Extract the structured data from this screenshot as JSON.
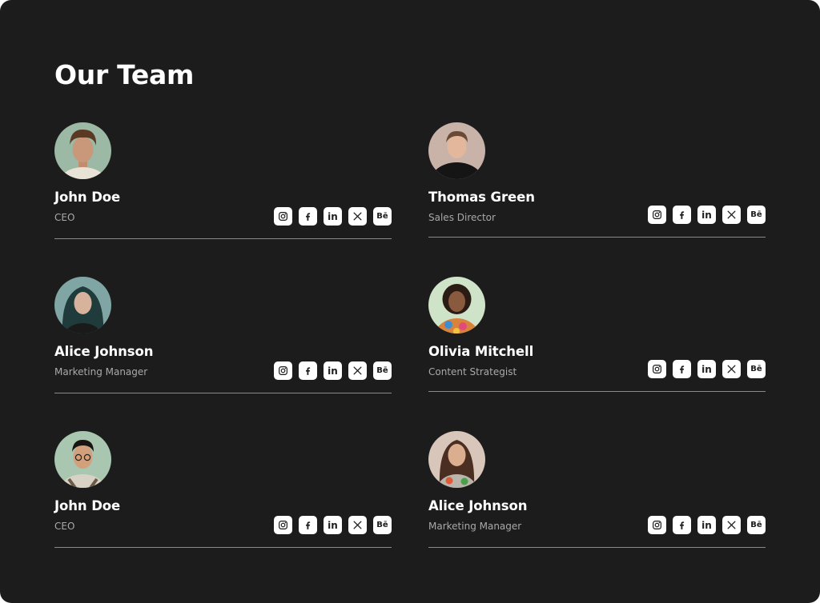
{
  "page": {
    "title": "Our Team"
  },
  "members": [
    {
      "name": "John Doe",
      "role": "CEO"
    },
    {
      "name": "Thomas Green",
      "role": "Sales Director"
    },
    {
      "name": "Alice Johnson",
      "role": "Marketing Manager"
    },
    {
      "name": "Olivia Mitchell",
      "role": "Content Strategist"
    },
    {
      "name": "John Doe",
      "role": "CEO"
    },
    {
      "name": "Alice Johnson",
      "role": "Marketing Manager"
    }
  ],
  "socials": {
    "instagram": "instagram-icon",
    "facebook": "facebook-icon",
    "linkedin": "in",
    "x": "x-icon",
    "behance": "Bē"
  },
  "colors": {
    "background": "#1c1c1c",
    "text_primary": "#ffffff",
    "text_secondary": "#a9a9a9",
    "divider": "#8a8a8a",
    "icon_tile": "#ffffff"
  }
}
